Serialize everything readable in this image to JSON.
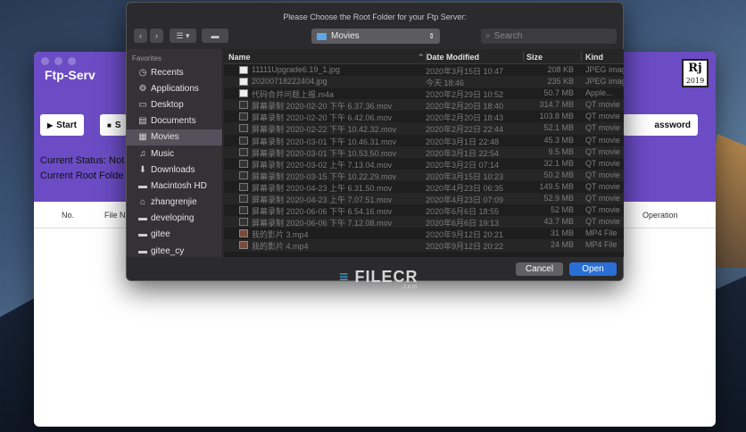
{
  "app": {
    "title": "Ftp-Serv",
    "logo_text": "Rj",
    "logo_year": "2019",
    "start_label": "Start",
    "stop_label": "S",
    "password_label": "assword",
    "status_label": "Current Status: Not",
    "root_label": "Current Root Folde",
    "columns": {
      "no": "No.",
      "filename": "File Na",
      "operation": "Operation"
    }
  },
  "dialog": {
    "title": "Please Choose the Root Folder for your Ftp Server:",
    "location": "Movies",
    "search_placeholder": "Search",
    "favorites_header": "Favorites",
    "sidebar": [
      {
        "label": "Recents",
        "icon": "clock-icon",
        "glyph": "◷"
      },
      {
        "label": "Applications",
        "icon": "applications-icon",
        "glyph": "⚙"
      },
      {
        "label": "Desktop",
        "icon": "desktop-icon",
        "glyph": "▭"
      },
      {
        "label": "Documents",
        "icon": "documents-icon",
        "glyph": "▤"
      },
      {
        "label": "Movies",
        "icon": "movies-icon",
        "glyph": "▦",
        "selected": true
      },
      {
        "label": "Music",
        "icon": "music-icon",
        "glyph": "♫"
      },
      {
        "label": "Downloads",
        "icon": "downloads-icon",
        "glyph": "⬇"
      },
      {
        "label": "Macintosh HD",
        "icon": "hard-drive-icon",
        "glyph": "▬"
      },
      {
        "label": "zhangrenjie",
        "icon": "home-icon",
        "glyph": "⌂"
      },
      {
        "label": "developing",
        "icon": "folder-icon",
        "glyph": "▬"
      },
      {
        "label": "gitee",
        "icon": "folder-icon",
        "glyph": "▬"
      },
      {
        "label": "gitee_cy",
        "icon": "folder-icon",
        "glyph": "▬"
      }
    ],
    "columns": {
      "name": "Name",
      "date": "Date Modified",
      "size": "Size",
      "kind": "Kind"
    },
    "files": [
      {
        "name": "11111Upgrade6.19_1.jpg",
        "date": "2020年3月15日 10:47",
        "size": "208 KB",
        "kind": "JPEG image",
        "type": "img"
      },
      {
        "name": "20200718222404.jpg",
        "date": "今天 18:46",
        "size": "235 KB",
        "kind": "JPEG image",
        "type": "img"
      },
      {
        "name": "代码合并问题上报.m4a",
        "date": "2020年2月29日 10:52",
        "size": "50.7 MB",
        "kind": "Apple...",
        "type": "img"
      },
      {
        "name": "屏幕录制 2020-02-20 下午 6.37.36.mov",
        "date": "2020年2月20日 18:40",
        "size": "314.7 MB",
        "kind": "QT movie",
        "type": "vid"
      },
      {
        "name": "屏幕录制 2020-02-20 下午 6.42.06.mov",
        "date": "2020年2月20日 18:43",
        "size": "103.8 MB",
        "kind": "QT movie",
        "type": "vid"
      },
      {
        "name": "屏幕录制 2020-02-22 下午 10.42.32.mov",
        "date": "2020年2月22日 22:44",
        "size": "52.1 MB",
        "kind": "QT movie",
        "type": "vid"
      },
      {
        "name": "屏幕录制 2020-03-01 下午 10.46.31.mov",
        "date": "2020年3月1日 22:48",
        "size": "45.3 MB",
        "kind": "QT movie",
        "type": "vid"
      },
      {
        "name": "屏幕录制 2020-03-01 下午 10.53.50.mov",
        "date": "2020年3月1日 22:54",
        "size": "9.5 MB",
        "kind": "QT movie",
        "type": "vid"
      },
      {
        "name": "屏幕录制 2020-03-02 上午 7.13.04.mov",
        "date": "2020年3月2日 07:14",
        "size": "32.1 MB",
        "kind": "QT movie",
        "type": "vid"
      },
      {
        "name": "屏幕录制 2020-03-15 下午 10.22.29.mov",
        "date": "2020年3月15日 10:23",
        "size": "50.2 MB",
        "kind": "QT movie",
        "type": "vid"
      },
      {
        "name": "屏幕录制 2020-04-23 上午 6.31.50.mov",
        "date": "2020年4月23日 06:35",
        "size": "149.5 MB",
        "kind": "QT movie",
        "type": "vid"
      },
      {
        "name": "屏幕录制 2020-04-23 上午 7.07.51.mov",
        "date": "2020年4月23日 07:09",
        "size": "52.9 MB",
        "kind": "QT movie",
        "type": "vid"
      },
      {
        "name": "屏幕录制 2020-06-06 下午 6.54.16.mov",
        "date": "2020年6月6日 18:55",
        "size": "52 MB",
        "kind": "QT movie",
        "type": "vid"
      },
      {
        "name": "屏幕录制 2020-06-06 下午 7.12.08.mov",
        "date": "2020年6月6日 19:13",
        "size": "43.7 MB",
        "kind": "QT movie",
        "type": "vid"
      },
      {
        "name": "我的影片 3.mp4",
        "date": "2020年9月12日 20:21",
        "size": "31 MB",
        "kind": "MP4 File",
        "type": "mp4"
      },
      {
        "name": "我的影片 4.mp4",
        "date": "2020年9月12日 20:22",
        "size": "24 MB",
        "kind": "MP4 File",
        "type": "mp4"
      }
    ],
    "cancel_label": "Cancel",
    "open_label": "Open"
  },
  "watermark": {
    "text": "FILECR",
    "sub": ".com"
  }
}
